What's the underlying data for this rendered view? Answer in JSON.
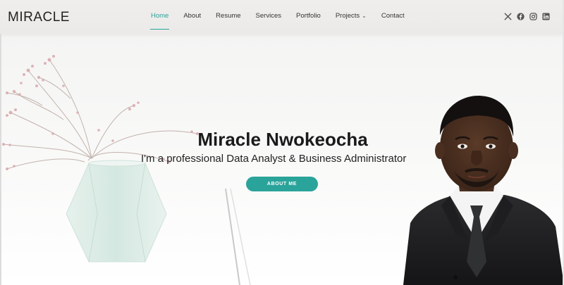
{
  "header": {
    "logo": "MIRACLE",
    "nav": [
      {
        "label": "Home",
        "active": true
      },
      {
        "label": "About",
        "active": false
      },
      {
        "label": "Resume",
        "active": false
      },
      {
        "label": "Services",
        "active": false
      },
      {
        "label": "Portfolio",
        "active": false
      },
      {
        "label": "Projects",
        "active": false,
        "dropdown": true
      },
      {
        "label": "Contact",
        "active": false
      }
    ],
    "social_icons": [
      "x-icon",
      "facebook-icon",
      "instagram-icon",
      "linkedin-icon"
    ]
  },
  "hero": {
    "name": "Miracle Nwokeocha",
    "subtitle": "I'm a professional Data Analyst & Business Administrator",
    "button_label": "ABOUT ME"
  },
  "colors": {
    "accent": "#2aa39a",
    "header_bg": "#ebeae8",
    "text_dark": "#1a1a1a"
  }
}
